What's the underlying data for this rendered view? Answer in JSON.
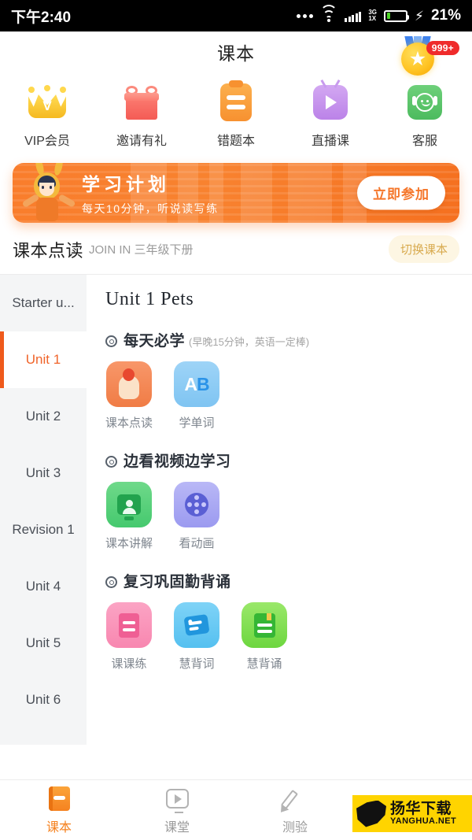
{
  "status_bar": {
    "time": "下午2:40",
    "network_top": "3G",
    "network_bottom": "1X",
    "battery_percent": "21%",
    "battery_level": 21,
    "icons": [
      "more-dots-icon",
      "wifi-icon",
      "signal-bars-icon",
      "battery-icon",
      "charging-bolt-icon"
    ]
  },
  "header": {
    "title": "课本",
    "medal_badge": "999+",
    "medal_icon": "star-medal-icon"
  },
  "quick_actions": [
    {
      "label": "VIP会员",
      "icon": "crown-icon",
      "crown_letter": "V"
    },
    {
      "label": "邀请有礼",
      "icon": "gift-icon"
    },
    {
      "label": "错题本",
      "icon": "clipboard-icon"
    },
    {
      "label": "直播课",
      "icon": "tv-play-icon"
    },
    {
      "label": "客服",
      "icon": "headset-support-icon"
    }
  ],
  "banner": {
    "title": "学习计划",
    "subtitle": "每天10分钟，听说读写练",
    "button": "立即参加",
    "mascot_icon": "bunny-mascot-icon",
    "bg_color": "#f8822f"
  },
  "section": {
    "title": "课本点读",
    "subtitle": "JOIN IN 三年级下册",
    "switch_button": "切换课本"
  },
  "sidebar": {
    "items": [
      {
        "label": "Starter u...",
        "active": false
      },
      {
        "label": "Unit 1",
        "active": true
      },
      {
        "label": "Unit 2",
        "active": false
      },
      {
        "label": "Unit 3",
        "active": false
      },
      {
        "label": "Revision 1",
        "active": false
      },
      {
        "label": "Unit 4",
        "active": false
      },
      {
        "label": "Unit 5",
        "active": false
      },
      {
        "label": "Unit 6",
        "active": false
      }
    ],
    "active_color": "#ef5a1c"
  },
  "content": {
    "unit_title": "Unit 1  Pets",
    "groups": [
      {
        "title": "每天必学",
        "note": "(早晚15分钟，英语一定棒)",
        "tiles": [
          {
            "label": "课本点读",
            "icon": "tap-to-read-icon"
          },
          {
            "label": "学单词",
            "icon": "ab-word-icon"
          }
        ]
      },
      {
        "title": "边看视频边学习",
        "note": "",
        "tiles": [
          {
            "label": "课本讲解",
            "icon": "teacher-monitor-icon"
          },
          {
            "label": "看动画",
            "icon": "film-reel-icon"
          }
        ]
      },
      {
        "title": "复习巩固勤背诵",
        "note": "",
        "tiles": [
          {
            "label": "课课练",
            "icon": "worksheet-icon"
          },
          {
            "label": "慧背词",
            "icon": "flashcard-icon"
          },
          {
            "label": "慧背诵",
            "icon": "recite-book-icon"
          }
        ]
      }
    ]
  },
  "tabbar": {
    "items": [
      {
        "label": "课本",
        "icon": "book-icon",
        "active": true
      },
      {
        "label": "课堂",
        "icon": "classroom-monitor-icon",
        "active": false
      },
      {
        "label": "测验",
        "icon": "pencil-icon",
        "active": false
      },
      {
        "label": "",
        "icon": "user-profile-icon",
        "active": false
      }
    ],
    "active_color": "#f58220"
  },
  "watermark": {
    "cn": "扬华下载",
    "en": "YANGHUA.NET",
    "bg_color": "#ffd400"
  }
}
